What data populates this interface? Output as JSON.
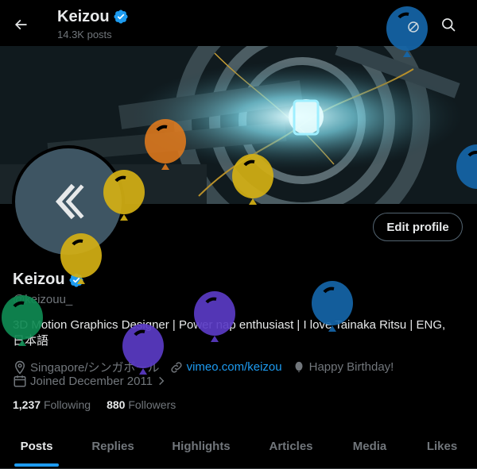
{
  "header": {
    "title": "Keizou",
    "post_count": "14.3K posts"
  },
  "profile": {
    "display_name": "Keizou",
    "handle": "@keizouu_",
    "edit_button": "Edit profile",
    "bio": "3D Motion Graphics Designer | Power nap enthusiast | I love Tainaka Ritsu | ENG, 日本語",
    "location": "Singapore/シンガポール",
    "website": "vimeo.com/keizou",
    "birthday": "Happy Birthday!",
    "joined": "Joined December 2011",
    "following_count": "1,237",
    "following_label": "Following",
    "followers_count": "880",
    "followers_label": "Followers"
  },
  "tabs": [
    {
      "label": "Posts",
      "active": true
    },
    {
      "label": "Replies",
      "active": false
    },
    {
      "label": "Highlights",
      "active": false
    },
    {
      "label": "Articles",
      "active": false
    },
    {
      "label": "Media",
      "active": false
    },
    {
      "label": "Likes",
      "active": false
    }
  ],
  "colors": {
    "accent": "#1d9bf0",
    "verified": "#1d9bf0",
    "background": "#000000",
    "muted_text": "#71767b",
    "balloon_blue": "#1565a8",
    "balloon_yellow": "#d4b014",
    "balloon_orange": "#e07a1c",
    "balloon_purple": "#5a3bc4",
    "balloon_green": "#0f8a52"
  },
  "icons": {
    "back": "arrow-left-icon",
    "search": "search-icon",
    "verified": "verified-badge-icon",
    "location": "location-pin-icon",
    "link": "link-icon",
    "birthday": "balloon-icon",
    "calendar": "calendar-icon"
  }
}
